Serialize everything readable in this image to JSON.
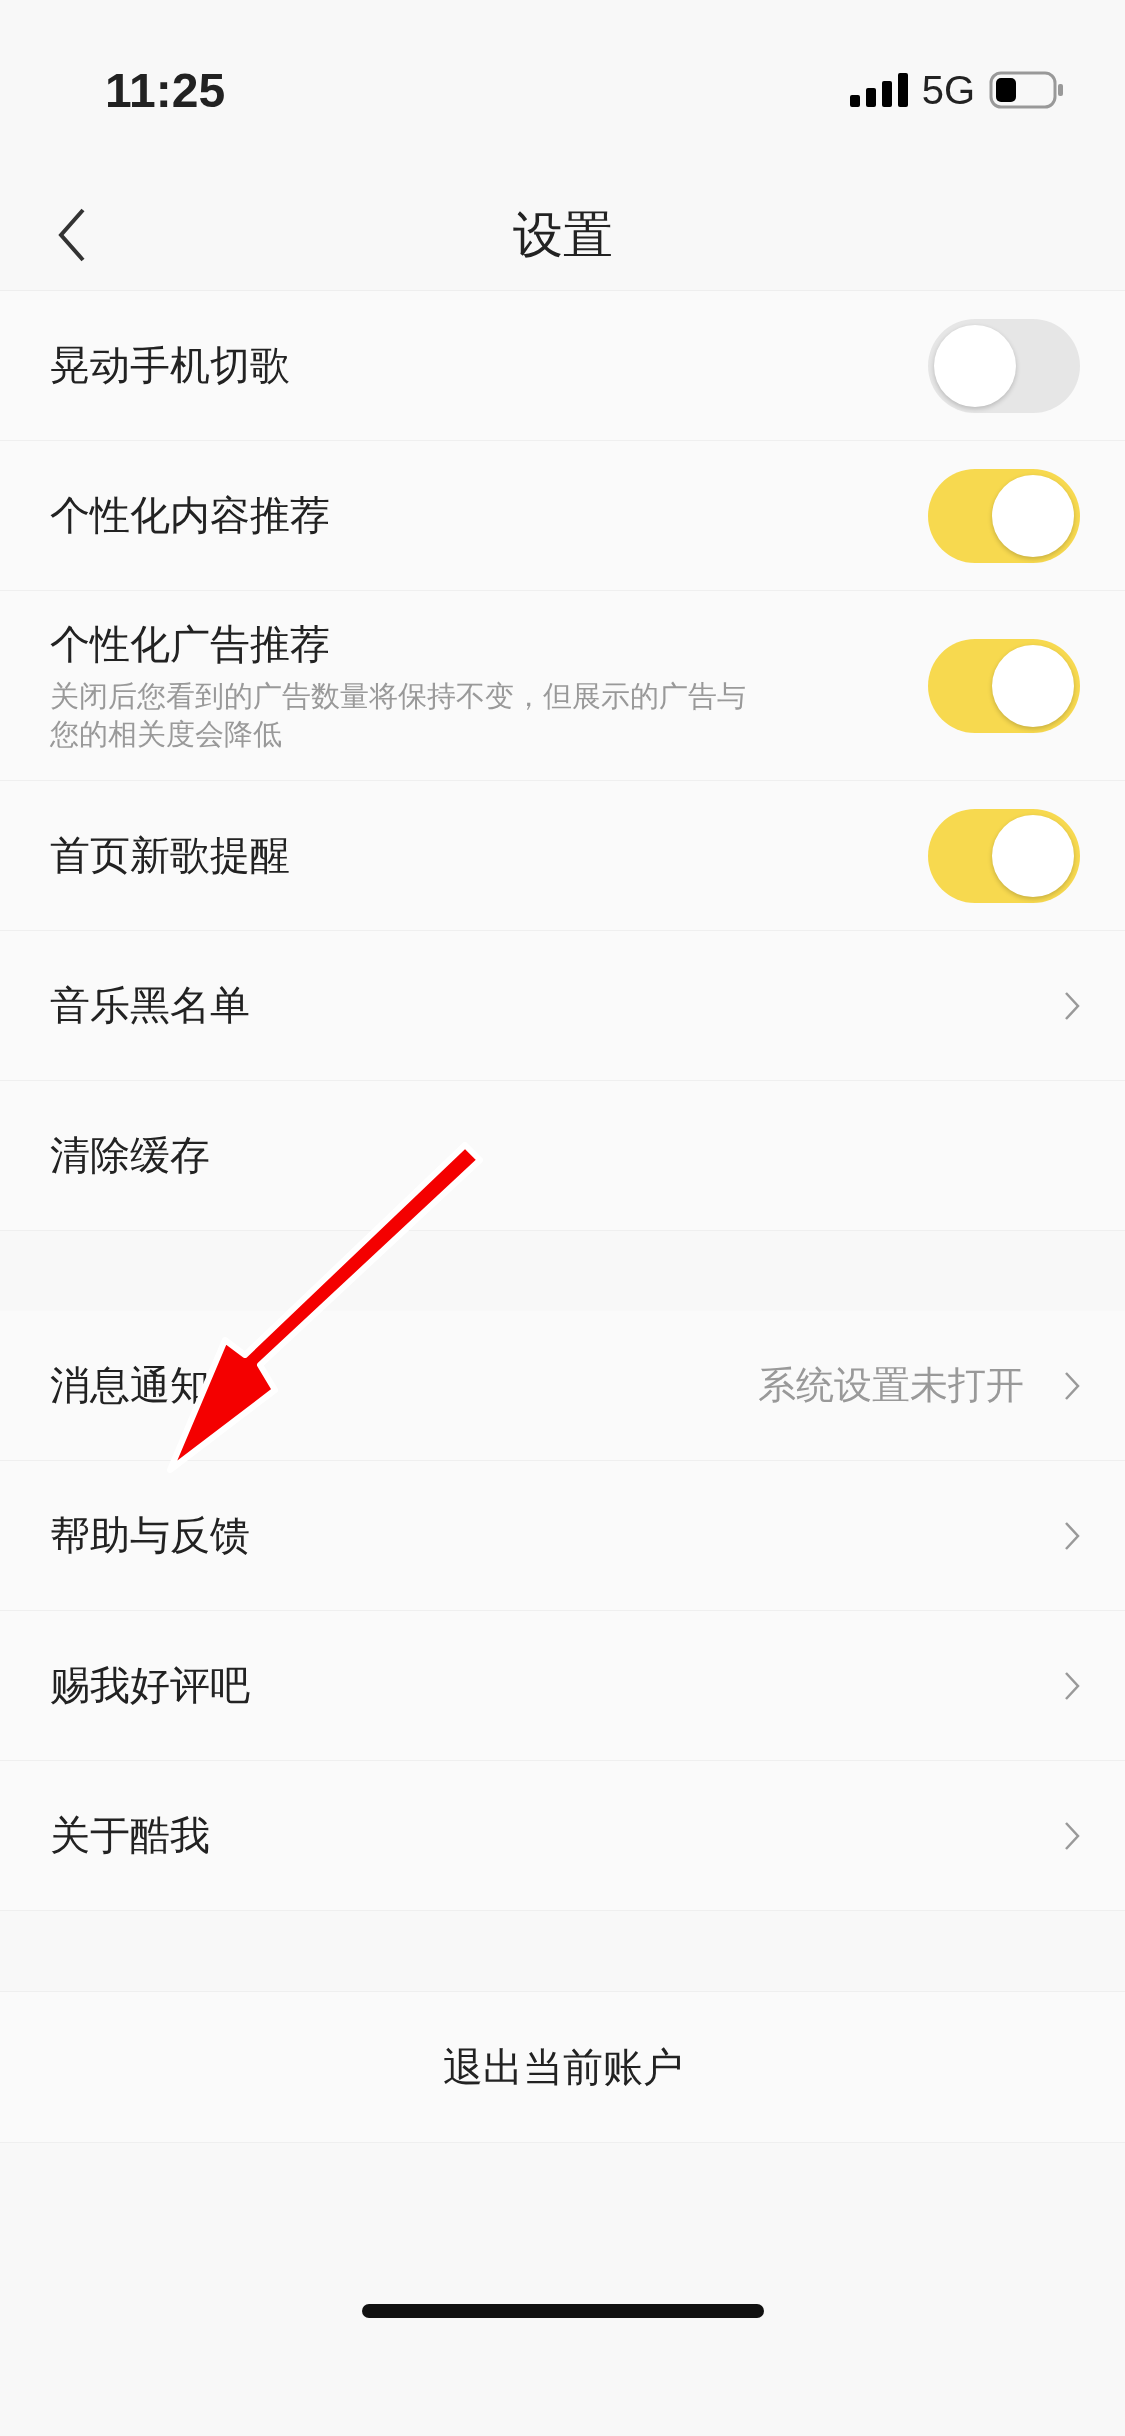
{
  "status_bar": {
    "time": "11:25",
    "network": "5G"
  },
  "nav": {
    "title": "设置"
  },
  "groups": [
    [
      {
        "kind": "toggle",
        "label": "晃动手机切歌",
        "on": false
      },
      {
        "kind": "toggle",
        "label": "个性化内容推荐",
        "on": true
      },
      {
        "kind": "toggle",
        "label": "个性化广告推荐",
        "description": "关闭后您看到的广告数量将保持不变，但展示的广告与您的相关度会降低",
        "on": true
      },
      {
        "kind": "toggle",
        "label": "首页新歌提醒",
        "on": true
      },
      {
        "kind": "link",
        "label": "音乐黑名单"
      },
      {
        "kind": "plain",
        "label": "清除缓存"
      }
    ],
    [
      {
        "kind": "link",
        "label": "消息通知",
        "value": "系统设置未打开"
      },
      {
        "kind": "link",
        "label": "帮助与反馈"
      },
      {
        "kind": "link",
        "label": "赐我好评吧"
      },
      {
        "kind": "link",
        "label": "关于酷我"
      }
    ]
  ],
  "logout": "退出当前账户"
}
